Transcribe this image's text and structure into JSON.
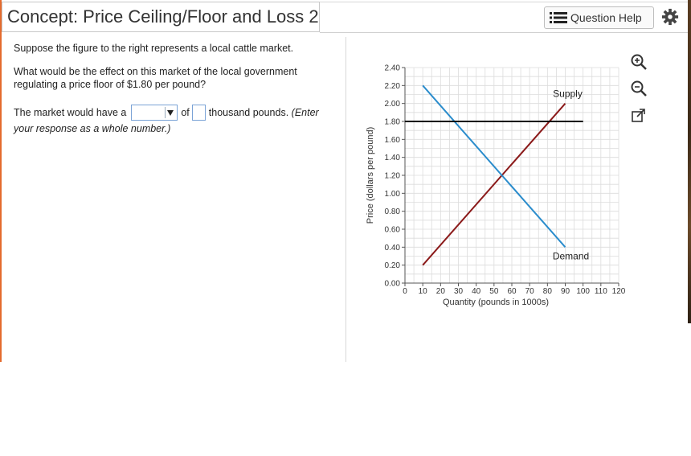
{
  "header": {
    "title": "Concept: Price Ceiling/Floor and Loss 2",
    "help_label": "Question Help"
  },
  "question": {
    "intro": "Suppose the figure to the right represents a local cattle market.",
    "main_line1": "What would be the effect on this market of the local government",
    "main_line2": "regulating a price floor of $1.80 per pound?",
    "answer_prefix": "The market would have a",
    "answer_of": "of",
    "answer_suffix": "thousand pounds.",
    "answer_hint_a": "(Enter",
    "answer_hint_b": "your response as a whole number.)",
    "dropdown_value": "",
    "number_value": ""
  },
  "tools": {
    "zoom_in": "zoom-in-icon",
    "zoom_out": "zoom-out-icon",
    "popout": "external-window-icon"
  },
  "chart_data": {
    "type": "line",
    "xlabel": "Quantity (pounds in 1000s)",
    "ylabel": "Price (dollars per pound)",
    "xlim": [
      0,
      120
    ],
    "ylim": [
      0,
      2.4
    ],
    "x_ticks": [
      "0",
      "10",
      "20",
      "30",
      "40",
      "50",
      "60",
      "70",
      "80",
      "90",
      "100",
      "110",
      "120"
    ],
    "y_ticks": [
      "0.00",
      "0.20",
      "0.40",
      "0.60",
      "0.80",
      "1.00",
      "1.20",
      "1.40",
      "1.60",
      "1.80",
      "2.00",
      "2.20",
      "2.40"
    ],
    "grid": true,
    "series": [
      {
        "name": "Supply",
        "color": "#8b1a1a",
        "x": [
          10,
          90
        ],
        "y": [
          0.2,
          2.0
        ]
      },
      {
        "name": "Demand",
        "color": "#2a8ccc",
        "x": [
          10,
          90
        ],
        "y": [
          2.2,
          0.4
        ]
      },
      {
        "name": "",
        "color": "#000000",
        "x": [
          0,
          100
        ],
        "y": [
          1.8,
          1.8
        ]
      }
    ]
  }
}
